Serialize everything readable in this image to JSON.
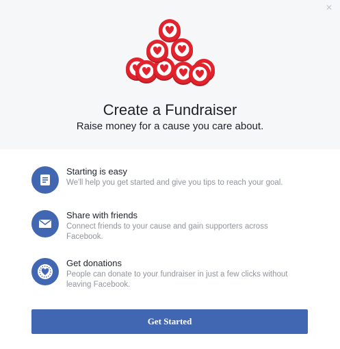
{
  "dialog": {
    "close_glyph": "×",
    "title": "Create a Fundraiser",
    "subtitle": "Raise money for a cause you care about.",
    "features": [
      {
        "icon": "document-icon",
        "title": "Starting is easy",
        "description": "We'll help you get started and give you tips to reach your goal."
      },
      {
        "icon": "envelope-icon",
        "title": "Share with friends",
        "description": "Connect friends to your cause and gain supporters across Facebook."
      },
      {
        "icon": "donation-heart-icon",
        "title": "Get donations",
        "description": "People can donate to your fundraiser in just a few clicks without leaving Facebook."
      }
    ],
    "cta_label": "Get Started"
  },
  "colors": {
    "accent": "#4267b2",
    "heart_red": "#e0232c",
    "hero_bg": "#f6f7f9",
    "muted_text": "#90949c"
  }
}
